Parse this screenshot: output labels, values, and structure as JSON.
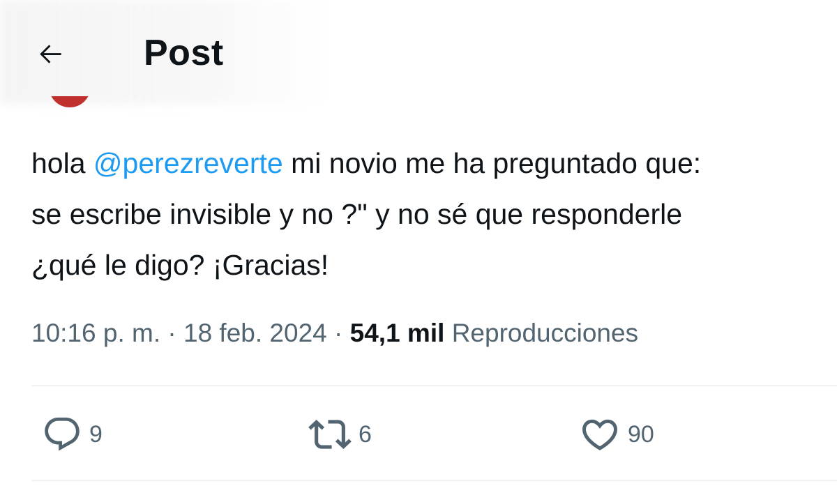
{
  "header": {
    "title": "Post",
    "back_icon": "arrow-left-icon"
  },
  "post": {
    "lines": [
      {
        "before": "hola ",
        "mention": "@perezreverte",
        "after": " mi novio me ha preguntado que:"
      },
      {
        "text": "se escribe invisible y no    ?\" y no sé que responderle"
      },
      {
        "text": "¿qué le digo? ¡Gracias!"
      }
    ],
    "time": "10:16 p. m.",
    "date": "18 feb. 2024",
    "separator": " · ",
    "views_count": "54,1 mil",
    "views_label": "Reproducciones"
  },
  "actions": {
    "replies": "9",
    "reposts": "6",
    "likes": "90",
    "reply_icon": "speech-bubble-icon",
    "repost_icon": "repost-arrows-icon",
    "like_icon": "heart-icon"
  },
  "colors": {
    "text": "#0f1419",
    "secondary": "#536471",
    "mention": "#1d9bf0",
    "divider": "#eff3f4"
  }
}
